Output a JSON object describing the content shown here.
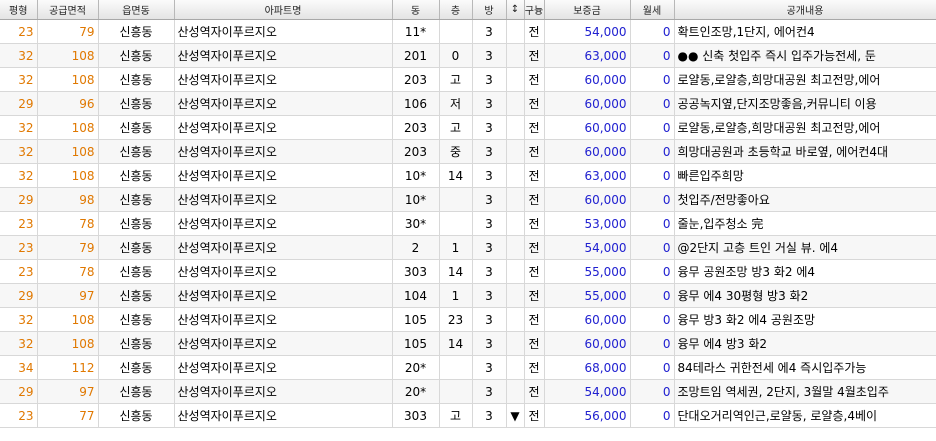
{
  "columns": [
    "평형",
    "공급면적",
    "읍면동",
    "아파트명",
    "동",
    "층",
    "방",
    "↕",
    "구늉",
    "보증금",
    "월세",
    "공개내용"
  ],
  "rows": [
    {
      "pyeong": "23",
      "area": "79",
      "dong_name": "신흥동",
      "apt": "산성역자이푸르지오",
      "dong": "11*",
      "floor": "",
      "rooms": "3",
      "mark": "",
      "type": "전",
      "deposit": "54,000",
      "rent": "0",
      "memo": "확트인조망,1단지, 에어컨4"
    },
    {
      "pyeong": "32",
      "area": "108",
      "dong_name": "신흥동",
      "apt": "산성역자이푸르지오",
      "dong": "201",
      "floor": "0",
      "rooms": "3",
      "mark": "",
      "type": "전",
      "deposit": "63,000",
      "rent": "0",
      "memo": "●● 신축 첫입주  즉시 입주가능전세, 둔"
    },
    {
      "pyeong": "32",
      "area": "108",
      "dong_name": "신흥동",
      "apt": "산성역자이푸르지오",
      "dong": "203",
      "floor": "고",
      "rooms": "3",
      "mark": "",
      "type": "전",
      "deposit": "60,000",
      "rent": "0",
      "memo": "로얄동,로얄층,희망대공원 최고전망,에어"
    },
    {
      "pyeong": "29",
      "area": "96",
      "dong_name": "신흥동",
      "apt": "산성역자이푸르지오",
      "dong": "106",
      "floor": "저",
      "rooms": "3",
      "mark": "",
      "type": "전",
      "deposit": "60,000",
      "rent": "0",
      "memo": "공공녹지옆,단지조망좋음,커뮤니티 이용"
    },
    {
      "pyeong": "32",
      "area": "108",
      "dong_name": "신흥동",
      "apt": "산성역자이푸르지오",
      "dong": "203",
      "floor": "고",
      "rooms": "3",
      "mark": "",
      "type": "전",
      "deposit": "60,000",
      "rent": "0",
      "memo": "로얄동,로얄층,희망대공원 최고전망,에어"
    },
    {
      "pyeong": "32",
      "area": "108",
      "dong_name": "신흥동",
      "apt": "산성역자이푸르지오",
      "dong": "203",
      "floor": "중",
      "rooms": "3",
      "mark": "",
      "type": "전",
      "deposit": "60,000",
      "rent": "0",
      "memo": "희망대공원과 초등학교 바로옆, 에어컨4대"
    },
    {
      "pyeong": "32",
      "area": "108",
      "dong_name": "신흥동",
      "apt": "산성역자이푸르지오",
      "dong": "10*",
      "floor": "14",
      "rooms": "3",
      "mark": "",
      "type": "전",
      "deposit": "63,000",
      "rent": "0",
      "memo": "빠른입주희망"
    },
    {
      "pyeong": "29",
      "area": "98",
      "dong_name": "신흥동",
      "apt": "산성역자이푸르지오",
      "dong": "10*",
      "floor": "",
      "rooms": "3",
      "mark": "",
      "type": "전",
      "deposit": "60,000",
      "rent": "0",
      "memo": "첫입주/전망좋아요"
    },
    {
      "pyeong": "23",
      "area": "78",
      "dong_name": "신흥동",
      "apt": "산성역자이푸르지오",
      "dong": "30*",
      "floor": "",
      "rooms": "3",
      "mark": "",
      "type": "전",
      "deposit": "53,000",
      "rent": "0",
      "memo": "줄눈,입주청소 完"
    },
    {
      "pyeong": "23",
      "area": "79",
      "dong_name": "신흥동",
      "apt": "산성역자이푸르지오",
      "dong": "2",
      "floor": "1",
      "rooms": "3",
      "mark": "",
      "type": "전",
      "deposit": "54,000",
      "rent": "0",
      "memo": "@2단지 고층 트인 거실 뷰. 에4"
    },
    {
      "pyeong": "23",
      "area": "78",
      "dong_name": "신흥동",
      "apt": "산성역자이푸르지오",
      "dong": "303",
      "floor": "14",
      "rooms": "3",
      "mark": "",
      "type": "전",
      "deposit": "55,000",
      "rent": "0",
      "memo": "융무 공원조망 방3 화2 에4"
    },
    {
      "pyeong": "29",
      "area": "97",
      "dong_name": "신흥동",
      "apt": "산성역자이푸르지오",
      "dong": "104",
      "floor": "1",
      "rooms": "3",
      "mark": "",
      "type": "전",
      "deposit": "55,000",
      "rent": "0",
      "memo": "융무 에4 30평형 방3 화2"
    },
    {
      "pyeong": "32",
      "area": "108",
      "dong_name": "신흥동",
      "apt": "산성역자이푸르지오",
      "dong": "105",
      "floor": "23",
      "rooms": "3",
      "mark": "",
      "type": "전",
      "deposit": "60,000",
      "rent": "0",
      "memo": "융무 방3 화2 에4 공원조망"
    },
    {
      "pyeong": "32",
      "area": "108",
      "dong_name": "신흥동",
      "apt": "산성역자이푸르지오",
      "dong": "105",
      "floor": "14",
      "rooms": "3",
      "mark": "",
      "type": "전",
      "deposit": "60,000",
      "rent": "0",
      "memo": "융무 에4 방3 화2"
    },
    {
      "pyeong": "34",
      "area": "112",
      "dong_name": "신흥동",
      "apt": "산성역자이푸르지오",
      "dong": "20*",
      "floor": "",
      "rooms": "3",
      "mark": "",
      "type": "전",
      "deposit": "68,000",
      "rent": "0",
      "memo": "84테라스 귀한전세 에4 즉시입주가능"
    },
    {
      "pyeong": "29",
      "area": "97",
      "dong_name": "신흥동",
      "apt": "산성역자이푸르지오",
      "dong": "20*",
      "floor": "",
      "rooms": "3",
      "mark": "",
      "type": "전",
      "deposit": "54,000",
      "rent": "0",
      "memo": "조망트임 역세권, 2단지, 3월말 4월초입주"
    },
    {
      "pyeong": "23",
      "area": "77",
      "dong_name": "신흥동",
      "apt": "산성역자이푸르지오",
      "dong": "303",
      "floor": "고",
      "rooms": "3",
      "mark": "▼",
      "type": "전",
      "deposit": "56,000",
      "rent": "0",
      "memo": "단대오거리역인근,로얄동, 로얄층,4베이"
    }
  ]
}
